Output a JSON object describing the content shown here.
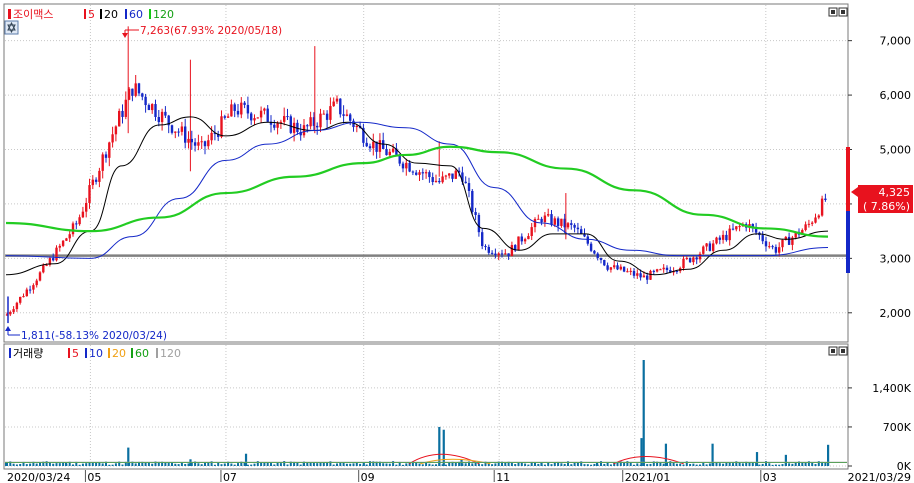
{
  "price_panel": {
    "title": "조이맥스",
    "ma_labels": [
      "5",
      "20",
      "60",
      "120"
    ],
    "ma_colors": [
      "#e8121e",
      "#000000",
      "#1428c8",
      "#14c814"
    ],
    "high_note": "7,263(67.93% 2020/05/18)",
    "low_note": "1,811(-58.13% 2020/03/24)",
    "current_price": "4,325",
    "current_change": "( 7.86%)"
  },
  "volume_panel": {
    "title": "거래량",
    "ma_labels": [
      "5",
      "10",
      "20",
      "60",
      "120"
    ],
    "ma_colors": [
      "#e8121e",
      "#1428c8",
      "#f0a014",
      "#14a014",
      "#a0a0a0"
    ]
  },
  "x_axis": {
    "labels": [
      "2020/03/24",
      "05",
      "07",
      "09",
      "11",
      "2021/01",
      "03",
      "2021/03/29"
    ]
  },
  "colors": {
    "up": "#e8121e",
    "down": "#1428c8",
    "ma5": "#e8121e",
    "ma20": "#000000",
    "ma60": "#1428c8",
    "ma120": "#22cc22",
    "support_line": "#808080",
    "volume_bar": "#0a6fa0",
    "price_box": "#e8121e"
  },
  "chart_data": [
    {
      "type": "line",
      "title": "조이맥스",
      "ylim": [
        1500,
        7600
      ],
      "y_ticks": [
        "7,000",
        "6,000",
        "5,000",
        "4,000",
        "3,000",
        "2,000"
      ],
      "y_tick_values": [
        7000,
        6000,
        5000,
        4000,
        3000,
        2000
      ],
      "horizontal_line": 3050,
      "series": [
        {
          "name": "5",
          "x": [
            "2020/03/24",
            "2020/04/10",
            "2020/04/25",
            "2020/05/10",
            "2020/05/20",
            "2020/06/05",
            "2020/06/20",
            "2020/07/05",
            "2020/07/20",
            "2020/08/05",
            "2020/08/20",
            "2020/09/05",
            "2020/09/20",
            "2020/10/05",
            "2020/10/15",
            "2020/10/25",
            "2020/11/05",
            "2020/11/20",
            "2020/12/05",
            "2020/12/20",
            "2021/01/05",
            "2021/01/20",
            "2021/02/05",
            "2021/02/20",
            "2021/03/05",
            "2021/03/20",
            "2021/03/29"
          ],
          "values": [
            1950,
            2800,
            3650,
            5200,
            6150,
            5500,
            5000,
            5750,
            5600,
            5350,
            5800,
            5100,
            4750,
            4400,
            4600,
            3200,
            3100,
            3750,
            3550,
            2850,
            2650,
            2850,
            3250,
            3650,
            3150,
            3600,
            4150
          ]
        },
        {
          "name": "20",
          "x": [
            "2020/03/24",
            "2020/04/15",
            "2020/05/01",
            "2020/05/15",
            "2020/06/01",
            "2020/06/15",
            "2020/07/01",
            "2020/07/20",
            "2020/08/10",
            "2020/08/25",
            "2020/09/10",
            "2020/09/25",
            "2020/10/10",
            "2020/10/25",
            "2020/11/10",
            "2020/11/25",
            "2020/12/10",
            "2020/12/25",
            "2021/01/10",
            "2021/01/25",
            "2021/02/10",
            "2021/02/25",
            "2021/03/10",
            "2021/03/29"
          ],
          "values": [
            2700,
            2900,
            3500,
            4700,
            5450,
            5600,
            5250,
            5500,
            5350,
            5500,
            5100,
            4750,
            4700,
            3550,
            3150,
            3450,
            3450,
            2950,
            2700,
            2800,
            3150,
            3450,
            3350,
            3500
          ]
        },
        {
          "name": "60",
          "x": [
            "2020/03/24",
            "2020/05/01",
            "2020/05/20",
            "2020/06/10",
            "2020/07/01",
            "2020/07/20",
            "2020/08/10",
            "2020/08/30",
            "2020/09/20",
            "2020/10/10",
            "2020/10/30",
            "2020/11/20",
            "2020/12/10",
            "2020/12/30",
            "2021/01/20",
            "2021/02/10",
            "2021/03/01",
            "2021/03/29"
          ],
          "values": [
            3050,
            3000,
            3400,
            4100,
            4800,
            5100,
            5350,
            5500,
            5400,
            5100,
            4300,
            3650,
            3350,
            3150,
            3050,
            3050,
            3050,
            3200
          ]
        },
        {
          "name": "120",
          "x": [
            "2020/03/24",
            "2020/05/01",
            "2020/06/01",
            "2020/07/01",
            "2020/08/01",
            "2020/09/01",
            "2020/09/20",
            "2020/10/10",
            "2020/11/01",
            "2020/12/01",
            "2021/01/01",
            "2021/02/01",
            "2021/03/01",
            "2021/03/29"
          ],
          "values": [
            3650,
            3500,
            3750,
            4200,
            4500,
            4750,
            4900,
            5050,
            4950,
            4650,
            4250,
            3800,
            3550,
            3400
          ]
        }
      ]
    },
    {
      "type": "bar",
      "title": "거래량",
      "ylim": [
        0,
        1900
      ],
      "y_ticks": [
        "1,400K",
        "700K",
        "0K"
      ],
      "y_tick_values": [
        1400,
        700,
        0
      ],
      "series": [
        {
          "name": "거래량 (K)",
          "x": [
            "2020/03/24",
            "2020/04/20",
            "2020/05/18",
            "2020/06/15",
            "2020/07/10",
            "2020/08/05",
            "2020/09/01",
            "2020/10/05",
            "2020/10/07",
            "2020/10/15",
            "2020/11/20",
            "2020/12/15",
            "2021/01/04",
            "2021/01/05",
            "2021/01/15",
            "2021/02/05",
            "2021/02/25",
            "2021/03/10",
            "2021/03/29"
          ],
          "values": [
            60,
            60,
            330,
            120,
            220,
            60,
            60,
            700,
            650,
            120,
            60,
            60,
            500,
            1900,
            400,
            400,
            250,
            200,
            380
          ]
        }
      ]
    }
  ]
}
